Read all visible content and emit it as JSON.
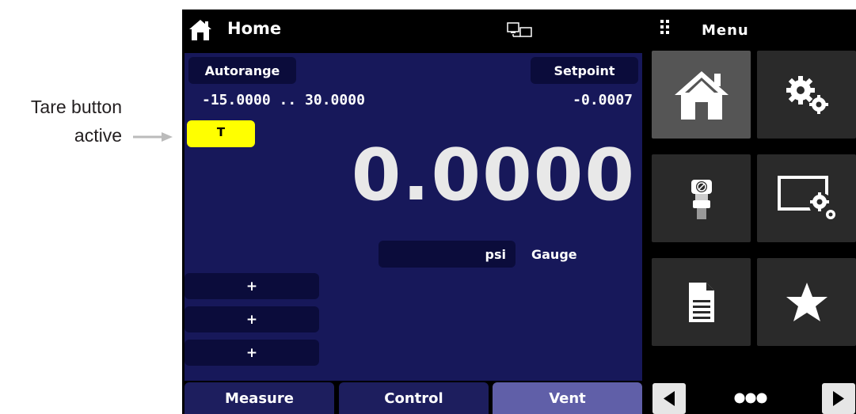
{
  "annotation": {
    "line1": "Tare button",
    "line2": "active"
  },
  "topbar": {
    "title": "Home",
    "home_icon": "home-icon",
    "network_icon": "network-icon",
    "menu_icon": "grip-icon",
    "menu_label": "Menu"
  },
  "main": {
    "autorange_label": "Autorange",
    "setpoint_label": "Setpoint",
    "range": "-15.0000 .. 30.0000",
    "setpoint_value": "-0.0007",
    "tare_label": "T",
    "reading": "0.0000",
    "unit": "psi",
    "mode": "Gauge",
    "plus_buttons": [
      "+",
      "+",
      "+"
    ]
  },
  "tabs": [
    {
      "label": "Measure",
      "active": false
    },
    {
      "label": "Control",
      "active": false
    },
    {
      "label": "Vent",
      "active": true
    }
  ],
  "menu_tiles": [
    {
      "icon": "home-icon",
      "selected": true
    },
    {
      "icon": "settings-gears-icon",
      "selected": false
    },
    {
      "icon": "pressure-controller-icon",
      "selected": false
    },
    {
      "icon": "display-settings-icon",
      "selected": false
    },
    {
      "icon": "document-icon",
      "selected": false
    },
    {
      "icon": "star-icon",
      "selected": false
    }
  ],
  "menu_nav": {
    "prev_icon": "left-arrow-icon",
    "page_indicator_icon": "page-dots-icon",
    "next_icon": "right-arrow-icon"
  },
  "colors": {
    "tare_active": "#ffff00",
    "main_panel": "#17185a",
    "vent_tab_active": "#605fa8"
  }
}
